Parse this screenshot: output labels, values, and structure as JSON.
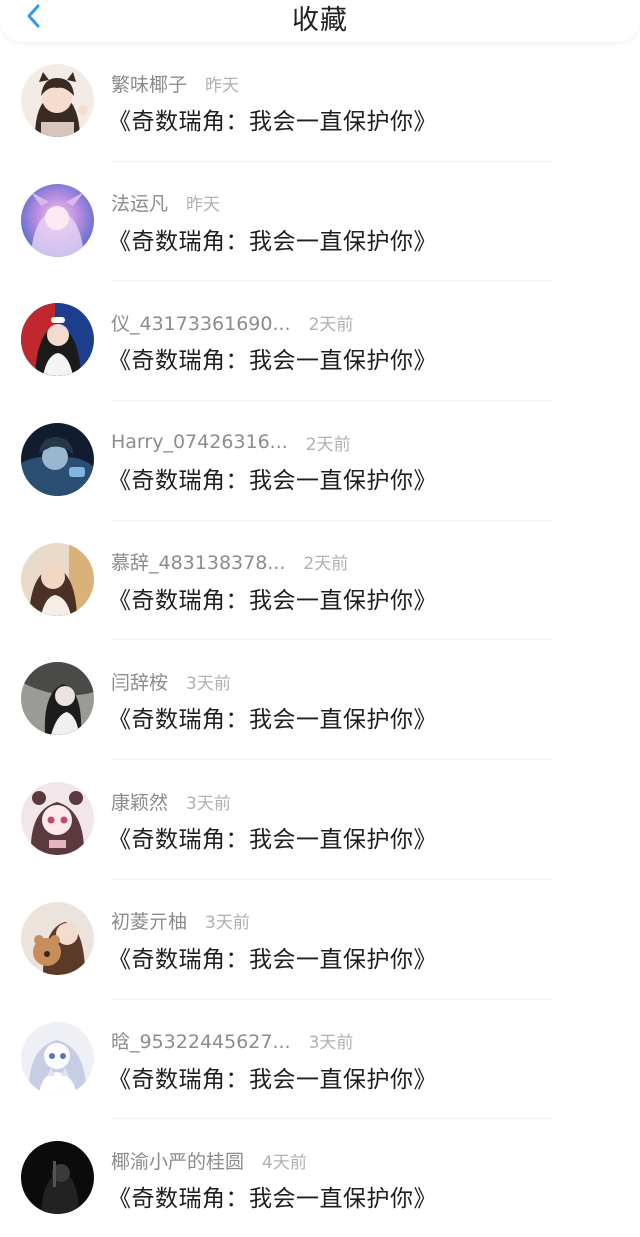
{
  "header": {
    "title": "收藏"
  },
  "colors": {
    "accent": "#2f9bf0",
    "name_text": "#8c8c8c",
    "time_text": "#b0b0b0",
    "title_text": "#1e1e1e"
  },
  "items": [
    {
      "name": "繁味椰子",
      "time": "昨天",
      "title": "《奇数瑞角：我会一直保护你》"
    },
    {
      "name": "法运凡",
      "time": "昨天",
      "title": "《奇数瑞角：我会一直保护你》"
    },
    {
      "name": "仪_43173361690...",
      "time": "2天前",
      "title": "《奇数瑞角：我会一直保护你》"
    },
    {
      "name": "Harry_07426316...",
      "time": "2天前",
      "title": "《奇数瑞角：我会一直保护你》"
    },
    {
      "name": "慕辞_483138378...",
      "time": "2天前",
      "title": "《奇数瑞角：我会一直保护你》"
    },
    {
      "name": "闫辞桉",
      "time": "3天前",
      "title": "《奇数瑞角：我会一直保护你》"
    },
    {
      "name": "康颖然",
      "time": "3天前",
      "title": "《奇数瑞角：我会一直保护你》"
    },
    {
      "name": "初菱亓柚",
      "time": "3天前",
      "title": "《奇数瑞角：我会一直保护你》"
    },
    {
      "name": "晗_95322445627...",
      "time": "3天前",
      "title": "《奇数瑞角：我会一直保护你》"
    },
    {
      "name": "椰渝小严的桂圆",
      "time": "4天前",
      "title": "《奇数瑞角：我会一直保护你》"
    }
  ]
}
